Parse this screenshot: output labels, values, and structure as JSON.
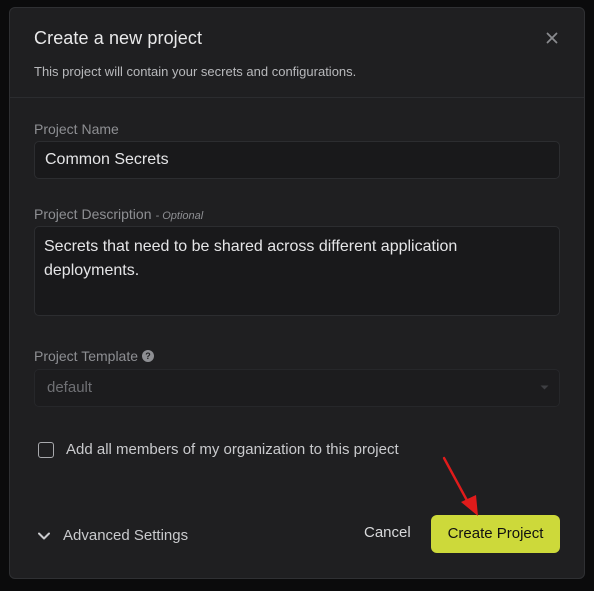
{
  "modal": {
    "title": "Create a new project",
    "subtitle": "This project will contain your secrets and configurations."
  },
  "fields": {
    "name": {
      "label": "Project Name",
      "value": "Common Secrets"
    },
    "description": {
      "label": "Project Description",
      "optional_tag": "- Optional",
      "value": "Secrets that need to be shared across different application deployments."
    },
    "template": {
      "label": "Project Template",
      "value": "default"
    }
  },
  "checkbox": {
    "label": "Add all members of my organization to this project",
    "checked": false
  },
  "footer": {
    "advanced_label": "Advanced Settings",
    "cancel_label": "Cancel",
    "create_label": "Create Project"
  },
  "icons": {
    "close": "close-icon",
    "help": "help-icon",
    "caret": "chevron-down-icon",
    "advanced": "chevron-down-icon",
    "annotation": "red-arrow-annotation"
  },
  "colors": {
    "accent": "#cdd93a",
    "annotation": "#e01b1b",
    "background": "#1f1f21"
  }
}
